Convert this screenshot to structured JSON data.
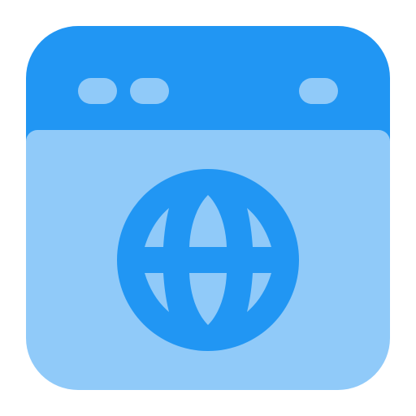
{
  "icon": {
    "name": "browser-globe-icon",
    "colors": {
      "frame_header": "#2196F3",
      "window_body": "#90CAF9",
      "dots": "#90CAF9",
      "globe": "#2196F3"
    }
  }
}
